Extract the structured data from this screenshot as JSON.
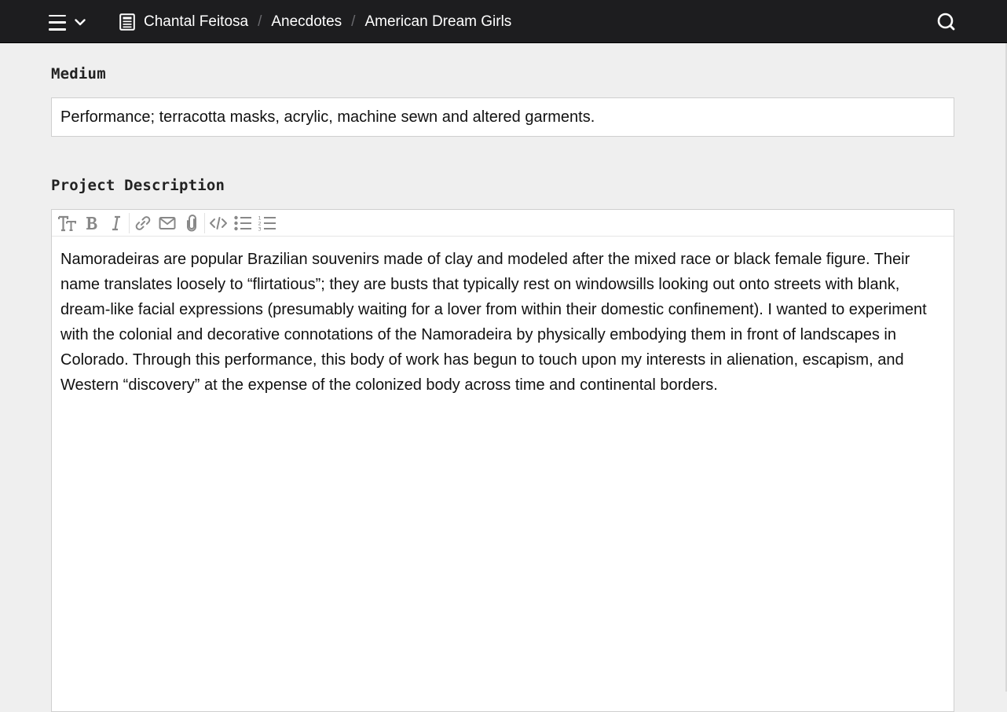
{
  "header": {
    "menu_icon": "hamburger-icon",
    "dropdown_icon": "chevron-down-icon",
    "doc_icon": "document-icon",
    "breadcrumb": [
      "Chantal Feitosa",
      "Anecdotes",
      "American Dream Girls"
    ],
    "breadcrumb_separator": "/",
    "search_icon": "search-icon"
  },
  "medium": {
    "label": "Medium",
    "value": "Performance; terracotta masks, acrylic, machine sewn and altered garments."
  },
  "project_description": {
    "label": "Project Description",
    "toolbar": [
      {
        "name": "text-size-icon",
        "glyph": "TT"
      },
      {
        "name": "bold-icon",
        "glyph": "B"
      },
      {
        "name": "italic-icon",
        "glyph": "I"
      },
      {
        "name": "link-icon"
      },
      {
        "name": "email-icon"
      },
      {
        "name": "attachment-icon"
      },
      {
        "name": "code-icon"
      },
      {
        "name": "bullet-list-icon"
      },
      {
        "name": "numbered-list-icon"
      }
    ],
    "text": "Namoradeiras are popular Brazilian souvenirs made of clay and modeled after the mixed race or black female figure. Their name translates loosely to “flirtatious”; they are busts that typically rest on windowsills looking out onto streets with blank, dream-like facial expressions (presumably waiting for a lover from within their domestic confinement). I wanted to experiment with the colonial and decorative connotations of the Namoradeira by physically embodying them in front of landscapes in Colorado. Through this performance, this body of work has begun to touch upon my interests in alienation, escapism, and Western “discovery” at the expense of the colonized body across time and continental borders."
  },
  "colors": {
    "topbar": "#1d1d1f",
    "page_background": "#efefef",
    "toolbar_icon": "#888888"
  }
}
